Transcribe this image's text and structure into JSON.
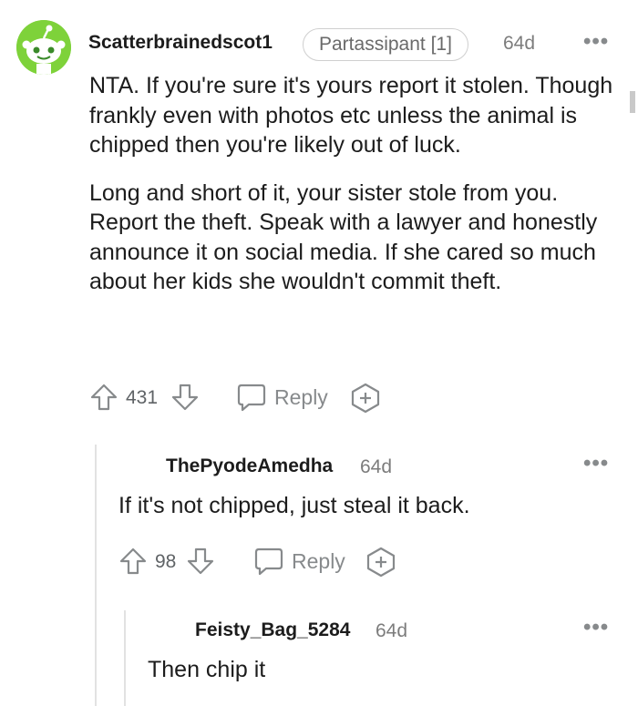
{
  "comments": [
    {
      "username": "Scatterbrainedscot1",
      "flair": "Partassipant [1]",
      "age": "64d",
      "paragraphs": [
        "NTA. If you're sure it's yours report it stolen. Though frankly even with photos etc unless the animal is chipped then you're likely out of luck.",
        "Long and short of it, your sister stole from you. Report the theft. Speak with a lawyer and honestly announce it on social media. If she cared so much about her kids she wouldn't commit theft."
      ],
      "score": "431",
      "reply_label": "Reply",
      "more": "•••"
    },
    {
      "username": "ThePyodeAmedha",
      "age": "64d",
      "text": "If it's not chipped, just steal it back.",
      "score": "98",
      "reply_label": "Reply",
      "more": "•••"
    },
    {
      "username": "Feisty_Bag_5284",
      "age": "64d",
      "text": "Then chip it",
      "more": "•••"
    }
  ],
  "icons": {
    "upvote": "arrow-up-icon",
    "downvote": "arrow-down-icon",
    "reply": "speech-bubble-icon",
    "award": "award-plus-icon",
    "avatar": "snoo-avatar"
  },
  "colors": {
    "avatar_bg": "#7ed23a",
    "text": "#1c1c1c",
    "meta": "#7c7c7c",
    "icon": "#878a8c"
  }
}
